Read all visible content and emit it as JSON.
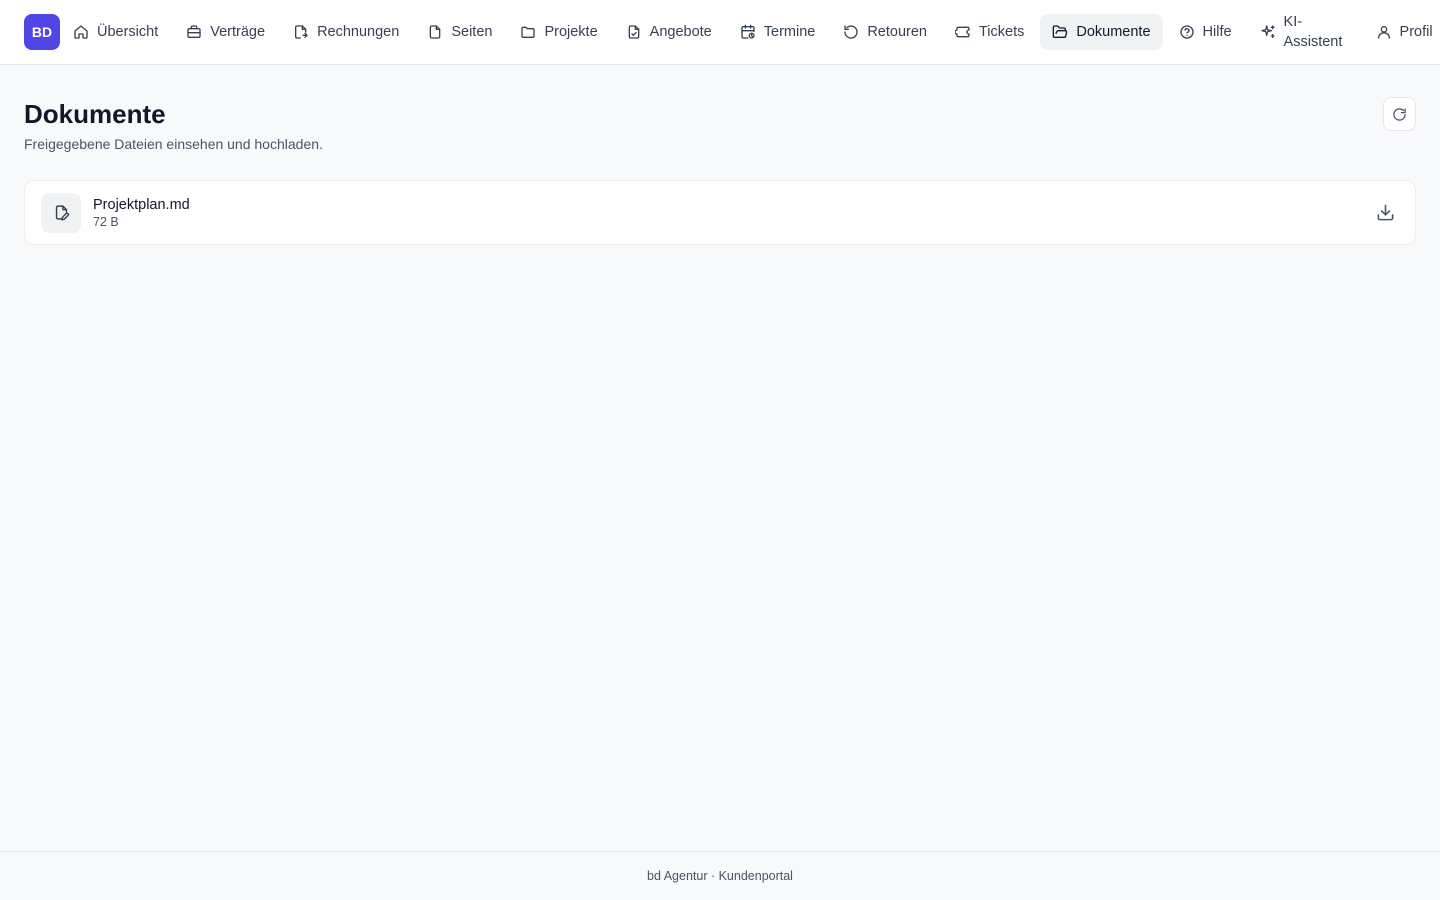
{
  "header": {
    "avatar_initials": "BD",
    "nav": [
      {
        "label": "Übersicht",
        "icon": "home-icon"
      },
      {
        "label": "Verträge",
        "icon": "briefcase-icon"
      },
      {
        "label": "Rechnungen",
        "icon": "invoice-icon"
      },
      {
        "label": "Seiten",
        "icon": "file-icon"
      },
      {
        "label": "Projekte",
        "icon": "folder-icon"
      },
      {
        "label": "Angebote",
        "icon": "file-check-icon"
      },
      {
        "label": "Termine",
        "icon": "calendar-clock-icon"
      },
      {
        "label": "Retouren",
        "icon": "undo-icon"
      },
      {
        "label": "Tickets",
        "icon": "ticket-icon"
      },
      {
        "label": "Dokumente",
        "icon": "folder-open-icon",
        "active": true
      },
      {
        "label": "Hilfe",
        "icon": "help-circle-icon"
      },
      {
        "label": "KI-Assistent",
        "icon": "sparkles-icon"
      },
      {
        "label": "Profil",
        "icon": "user-icon"
      }
    ]
  },
  "main": {
    "title": "Dokumente",
    "subtitle": "Freigegebene Dateien einsehen und hochladen.",
    "files": [
      {
        "name": "Projektplan.md",
        "size": "72 B"
      }
    ]
  },
  "footer": {
    "text": "bd Agentur · Kundenportal"
  },
  "colors": {
    "accent": "#4f46e5",
    "background": "#f8f9fb",
    "active_nav_bg": "#f1f2f4"
  }
}
